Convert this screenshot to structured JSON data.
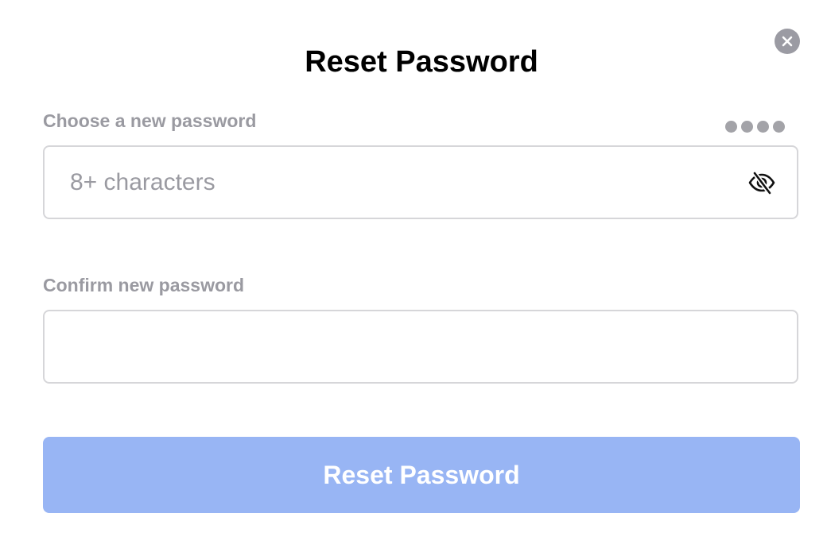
{
  "dialog": {
    "title": "Reset Password",
    "close_icon": "close-icon"
  },
  "new_password": {
    "label": "Choose a new password",
    "placeholder": "8+ characters",
    "value": "",
    "strength_dots": 4,
    "toggle_icon": "eye-slash-icon"
  },
  "confirm_password": {
    "label": "Confirm new password",
    "placeholder": "",
    "value": ""
  },
  "submit": {
    "label": "Reset Password",
    "enabled": false
  },
  "colors": {
    "label_gray": "#9a9aa1",
    "border": "#d6d6d9",
    "submit_bg_disabled": "#98b5f4",
    "close_bg": "#9b9ba3",
    "strength_dot": "#a3a3a8"
  }
}
